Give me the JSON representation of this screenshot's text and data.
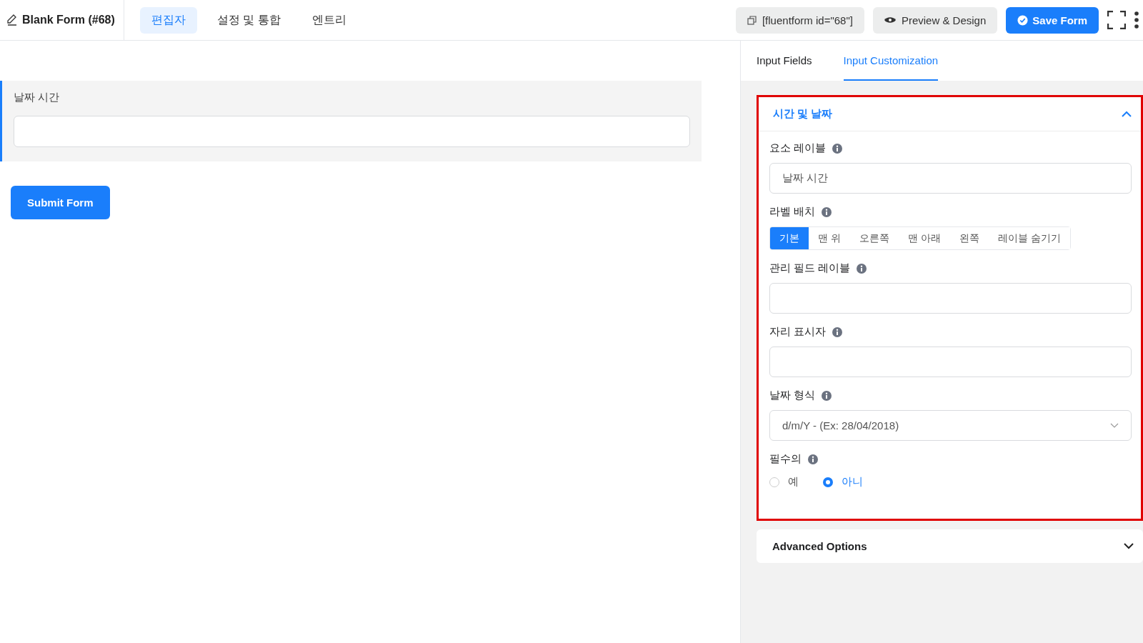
{
  "header": {
    "form_title": "Blank Form (#68)",
    "tabs": [
      {
        "label": "편집자",
        "selected": true
      },
      {
        "label": "설정 및 통합",
        "selected": false
      },
      {
        "label": "엔트리",
        "selected": false
      }
    ],
    "shortcode": "[fluentform id=\"68\"]",
    "preview_button": "Preview & Design",
    "save_button": "Save Form"
  },
  "canvas": {
    "field_label": "날짜 시간",
    "submit_button": "Submit Form"
  },
  "sidebar": {
    "tabs": [
      {
        "label": "Input Fields",
        "selected": false
      },
      {
        "label": "Input Customization",
        "selected": true
      }
    ],
    "section": {
      "title": "시간 및 날짜",
      "expanded": true,
      "highlighted": true,
      "settings": [
        {
          "kind": "text",
          "label": "요소 레이블",
          "value": "날짜 시간"
        },
        {
          "kind": "segmented",
          "label": "라벨 배치",
          "options": [
            {
              "label": "기본",
              "selected": true
            },
            {
              "label": "맨 위",
              "selected": false
            },
            {
              "label": "오른쪽",
              "selected": false
            },
            {
              "label": "맨 아래",
              "selected": false
            },
            {
              "label": "왼쪽",
              "selected": false
            },
            {
              "label": "레이블 숨기기",
              "selected": false
            }
          ]
        },
        {
          "kind": "text",
          "label": "관리 필드 레이블"
        },
        {
          "kind": "text",
          "label": "자리 표시자"
        },
        {
          "kind": "select",
          "label": "날짜 형식",
          "value": "d/m/Y - (Ex: 28/04/2018)"
        },
        {
          "kind": "radio",
          "label": "필수의",
          "options": [
            {
              "label": "예",
              "selected": false
            },
            {
              "label": "아니",
              "selected": true
            }
          ]
        }
      ]
    },
    "advanced": {
      "title": "Advanced Options",
      "expanded": false
    }
  }
}
